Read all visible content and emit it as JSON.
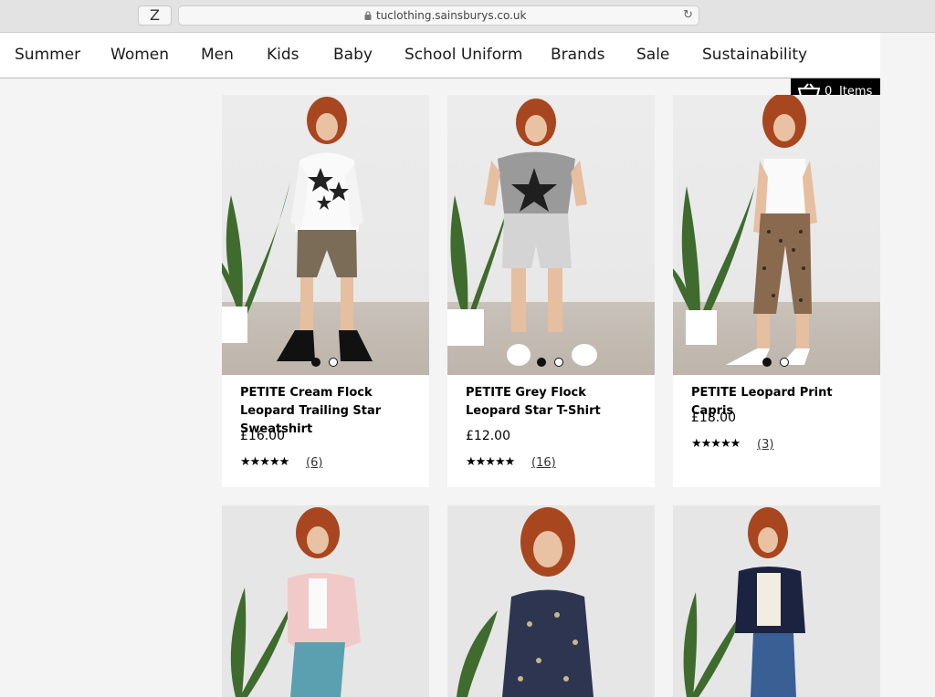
{
  "browser": {
    "tab_button": "Z",
    "url": "tuclothing.sainsburys.co.uk"
  },
  "nav": {
    "items": [
      "Summer",
      "Women",
      "Men",
      "Kids",
      "Baby",
      "School Uniform",
      "Brands",
      "Sale",
      "Sustainability"
    ]
  },
  "basket": {
    "count": "0",
    "label": "Items"
  },
  "products": [
    {
      "title": "PETITE Cream Flock Leopard Trailing Star Sweatshirt",
      "price": "£16.00",
      "stars": "★★★★★",
      "rating": 4.5,
      "reviews": "(6)"
    },
    {
      "title": "PETITE Grey Flock Leopard Star T-Shirt",
      "price": "£12.00",
      "stars": "★★★★★",
      "rating": 5,
      "reviews": "(16)"
    },
    {
      "title": "PETITE Leopard Print Capris",
      "price": "£18.00",
      "stars": "★★★★★",
      "rating": 5,
      "reviews": "(3)"
    }
  ],
  "colors": {
    "nav_background": "#ffffff",
    "basket_background": "#000000",
    "page_background": "#f4f4f4"
  }
}
